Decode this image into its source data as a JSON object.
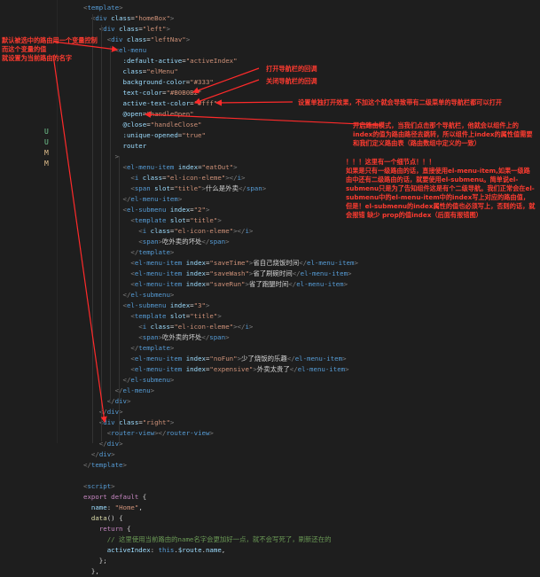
{
  "git_marks": [
    {
      "letter": "U",
      "color": "#73c991"
    },
    {
      "letter": "U",
      "color": "#73c991"
    },
    {
      "letter": "M",
      "color": "#e2c08d"
    },
    {
      "letter": "M",
      "color": "#e2c08d"
    }
  ],
  "code_lines": [
    [
      [
        "t-br",
        "<"
      ],
      [
        "t-tag",
        "template"
      ],
      [
        "t-br",
        ">"
      ]
    ],
    [
      [
        "t-br",
        "  <"
      ],
      [
        "t-tag",
        "div"
      ],
      [
        "t-txt",
        " "
      ],
      [
        "t-attr",
        "class"
      ],
      [
        "t-txt",
        "="
      ],
      [
        "t-str",
        "\"homeBox\""
      ],
      [
        "t-br",
        ">"
      ]
    ],
    [
      [
        "t-br",
        "    <"
      ],
      [
        "t-tag",
        "div"
      ],
      [
        "t-txt",
        " "
      ],
      [
        "t-attr",
        "class"
      ],
      [
        "t-txt",
        "="
      ],
      [
        "t-str",
        "\"left\""
      ],
      [
        "t-br",
        ">"
      ]
    ],
    [
      [
        "t-br",
        "      <"
      ],
      [
        "t-tag",
        "div"
      ],
      [
        "t-txt",
        " "
      ],
      [
        "t-attr",
        "class"
      ],
      [
        "t-txt",
        "="
      ],
      [
        "t-str",
        "\"leftNav\""
      ],
      [
        "t-br",
        ">"
      ]
    ],
    [
      [
        "t-br",
        "        <"
      ],
      [
        "t-tag",
        "el-menu"
      ]
    ],
    [
      [
        "t-txt",
        "          "
      ],
      [
        "t-attr",
        ":default-active"
      ],
      [
        "t-txt",
        "="
      ],
      [
        "t-str",
        "\"activeIndex\""
      ]
    ],
    [
      [
        "t-txt",
        "          "
      ],
      [
        "t-attr",
        "class"
      ],
      [
        "t-txt",
        "="
      ],
      [
        "t-str",
        "\"elMenu\""
      ]
    ],
    [
      [
        "t-txt",
        "          "
      ],
      [
        "t-attr",
        "background-color"
      ],
      [
        "t-txt",
        "="
      ],
      [
        "t-str",
        "\"#333\""
      ]
    ],
    [
      [
        "t-txt",
        "          "
      ],
      [
        "t-attr",
        "text-color"
      ],
      [
        "t-txt",
        "="
      ],
      [
        "t-str",
        "\"#B0B0B2\""
      ]
    ],
    [
      [
        "t-txt",
        "          "
      ],
      [
        "t-attr",
        "active-text-color"
      ],
      [
        "t-txt",
        "="
      ],
      [
        "t-str",
        "\"#fff\""
      ]
    ],
    [
      [
        "t-txt",
        "          "
      ],
      [
        "t-attr",
        "@open"
      ],
      [
        "t-txt",
        "="
      ],
      [
        "t-str",
        "\"handleOpen\""
      ]
    ],
    [
      [
        "t-txt",
        "          "
      ],
      [
        "t-attr",
        "@close"
      ],
      [
        "t-txt",
        "="
      ],
      [
        "t-str",
        "\"handleClose\""
      ]
    ],
    [
      [
        "t-txt",
        "          "
      ],
      [
        "t-attr",
        ":unique-opened"
      ],
      [
        "t-txt",
        "="
      ],
      [
        "t-str",
        "\"true\""
      ]
    ],
    [
      [
        "t-txt",
        "          "
      ],
      [
        "t-attr",
        "router"
      ]
    ],
    [
      [
        "t-br",
        "        >"
      ]
    ],
    [
      [
        "t-br",
        "          <"
      ],
      [
        "t-tag",
        "el-menu-item"
      ],
      [
        "t-txt",
        " "
      ],
      [
        "t-attr",
        "index"
      ],
      [
        "t-txt",
        "="
      ],
      [
        "t-str",
        "\"eatOut\""
      ],
      [
        "t-br",
        ">"
      ]
    ],
    [
      [
        "t-br",
        "            <"
      ],
      [
        "t-tag",
        "i"
      ],
      [
        "t-txt",
        " "
      ],
      [
        "t-attr",
        "class"
      ],
      [
        "t-txt",
        "="
      ],
      [
        "t-str",
        "\"el-icon-eleme\""
      ],
      [
        "t-br",
        "></"
      ],
      [
        "t-tag",
        "i"
      ],
      [
        "t-br",
        ">"
      ]
    ],
    [
      [
        "t-br",
        "            <"
      ],
      [
        "t-tag",
        "span"
      ],
      [
        "t-txt",
        " "
      ],
      [
        "t-attr",
        "slot"
      ],
      [
        "t-txt",
        "="
      ],
      [
        "t-str",
        "\"title\""
      ],
      [
        "t-br",
        ">"
      ],
      [
        "t-txt",
        "什么是外卖"
      ],
      [
        "t-br",
        "</"
      ],
      [
        "t-tag",
        "span"
      ],
      [
        "t-br",
        ">"
      ]
    ],
    [
      [
        "t-br",
        "          </"
      ],
      [
        "t-tag",
        "el-menu-item"
      ],
      [
        "t-br",
        ">"
      ]
    ],
    [
      [
        "t-br",
        "          <"
      ],
      [
        "t-tag",
        "el-submenu"
      ],
      [
        "t-txt",
        " "
      ],
      [
        "t-attr",
        "index"
      ],
      [
        "t-txt",
        "="
      ],
      [
        "t-str",
        "\"2\""
      ],
      [
        "t-br",
        ">"
      ]
    ],
    [
      [
        "t-br",
        "            <"
      ],
      [
        "t-tag",
        "template"
      ],
      [
        "t-txt",
        " "
      ],
      [
        "t-attr",
        "slot"
      ],
      [
        "t-txt",
        "="
      ],
      [
        "t-str",
        "\"title\""
      ],
      [
        "t-br",
        ">"
      ]
    ],
    [
      [
        "t-br",
        "              <"
      ],
      [
        "t-tag",
        "i"
      ],
      [
        "t-txt",
        " "
      ],
      [
        "t-attr",
        "class"
      ],
      [
        "t-txt",
        "="
      ],
      [
        "t-str",
        "\"el-icon-eleme\""
      ],
      [
        "t-br",
        "></"
      ],
      [
        "t-tag",
        "i"
      ],
      [
        "t-br",
        ">"
      ]
    ],
    [
      [
        "t-br",
        "              <"
      ],
      [
        "t-tag",
        "span"
      ],
      [
        "t-br",
        ">"
      ],
      [
        "t-txt",
        "吃外卖的坏处"
      ],
      [
        "t-br",
        "</"
      ],
      [
        "t-tag",
        "span"
      ],
      [
        "t-br",
        ">"
      ]
    ],
    [
      [
        "t-br",
        "            </"
      ],
      [
        "t-tag",
        "template"
      ],
      [
        "t-br",
        ">"
      ]
    ],
    [
      [
        "t-br",
        "            <"
      ],
      [
        "t-tag",
        "el-menu-item"
      ],
      [
        "t-txt",
        " "
      ],
      [
        "t-attr",
        "index"
      ],
      [
        "t-txt",
        "="
      ],
      [
        "t-str",
        "\"saveTime\""
      ],
      [
        "t-br",
        ">"
      ],
      [
        "t-txt",
        "省自己烧饭时间"
      ],
      [
        "t-br",
        "</"
      ],
      [
        "t-tag",
        "el-menu-item"
      ],
      [
        "t-br",
        ">"
      ]
    ],
    [
      [
        "t-br",
        "            <"
      ],
      [
        "t-tag",
        "el-menu-item"
      ],
      [
        "t-txt",
        " "
      ],
      [
        "t-attr",
        "index"
      ],
      [
        "t-txt",
        "="
      ],
      [
        "t-str",
        "\"saveWash\""
      ],
      [
        "t-br",
        ">"
      ],
      [
        "t-txt",
        "省了刷碗时间"
      ],
      [
        "t-br",
        "</"
      ],
      [
        "t-tag",
        "el-menu-item"
      ],
      [
        "t-br",
        ">"
      ]
    ],
    [
      [
        "t-br",
        "            <"
      ],
      [
        "t-tag",
        "el-menu-item"
      ],
      [
        "t-txt",
        " "
      ],
      [
        "t-attr",
        "index"
      ],
      [
        "t-txt",
        "="
      ],
      [
        "t-str",
        "\"saveRun\""
      ],
      [
        "t-br",
        ">"
      ],
      [
        "t-txt",
        "省了跑腿时间"
      ],
      [
        "t-br",
        "</"
      ],
      [
        "t-tag",
        "el-menu-item"
      ],
      [
        "t-br",
        ">"
      ]
    ],
    [
      [
        "t-br",
        "          </"
      ],
      [
        "t-tag",
        "el-submenu"
      ],
      [
        "t-br",
        ">"
      ]
    ],
    [
      [
        "t-br",
        "          <"
      ],
      [
        "t-tag",
        "el-submenu"
      ],
      [
        "t-txt",
        " "
      ],
      [
        "t-attr",
        "index"
      ],
      [
        "t-txt",
        "="
      ],
      [
        "t-str",
        "\"3\""
      ],
      [
        "t-br",
        ">"
      ]
    ],
    [
      [
        "t-br",
        "            <"
      ],
      [
        "t-tag",
        "template"
      ],
      [
        "t-txt",
        " "
      ],
      [
        "t-attr",
        "slot"
      ],
      [
        "t-txt",
        "="
      ],
      [
        "t-str",
        "\"title\""
      ],
      [
        "t-br",
        ">"
      ]
    ],
    [
      [
        "t-br",
        "              <"
      ],
      [
        "t-tag",
        "i"
      ],
      [
        "t-txt",
        " "
      ],
      [
        "t-attr",
        "class"
      ],
      [
        "t-txt",
        "="
      ],
      [
        "t-str",
        "\"el-icon-eleme\""
      ],
      [
        "t-br",
        "></"
      ],
      [
        "t-tag",
        "i"
      ],
      [
        "t-br",
        ">"
      ]
    ],
    [
      [
        "t-br",
        "              <"
      ],
      [
        "t-tag",
        "span"
      ],
      [
        "t-br",
        ">"
      ],
      [
        "t-txt",
        "吃外卖的坏处"
      ],
      [
        "t-br",
        "</"
      ],
      [
        "t-tag",
        "span"
      ],
      [
        "t-br",
        ">"
      ]
    ],
    [
      [
        "t-br",
        "            </"
      ],
      [
        "t-tag",
        "template"
      ],
      [
        "t-br",
        ">"
      ]
    ],
    [
      [
        "t-br",
        "            <"
      ],
      [
        "t-tag",
        "el-menu-item"
      ],
      [
        "t-txt",
        " "
      ],
      [
        "t-attr",
        "index"
      ],
      [
        "t-txt",
        "="
      ],
      [
        "t-str",
        "\"noFun\""
      ],
      [
        "t-br",
        ">"
      ],
      [
        "t-txt",
        "少了烧饭的乐趣"
      ],
      [
        "t-br",
        "</"
      ],
      [
        "t-tag",
        "el-menu-item"
      ],
      [
        "t-br",
        ">"
      ]
    ],
    [
      [
        "t-br",
        "            <"
      ],
      [
        "t-tag",
        "el-menu-item"
      ],
      [
        "t-txt",
        " "
      ],
      [
        "t-attr",
        "index"
      ],
      [
        "t-txt",
        "="
      ],
      [
        "t-str",
        "\"expensive\""
      ],
      [
        "t-br",
        ">"
      ],
      [
        "t-txt",
        "外卖太贵了"
      ],
      [
        "t-br",
        "</"
      ],
      [
        "t-tag",
        "el-menu-item"
      ],
      [
        "t-br",
        ">"
      ]
    ],
    [
      [
        "t-br",
        "          </"
      ],
      [
        "t-tag",
        "el-submenu"
      ],
      [
        "t-br",
        ">"
      ]
    ],
    [
      [
        "t-br",
        "        </"
      ],
      [
        "t-tag",
        "el-menu"
      ],
      [
        "t-br",
        ">"
      ]
    ],
    [
      [
        "t-br",
        "      </"
      ],
      [
        "t-tag",
        "div"
      ],
      [
        "t-br",
        ">"
      ]
    ],
    [
      [
        "t-br",
        "    </"
      ],
      [
        "t-tag",
        "div"
      ],
      [
        "t-br",
        ">"
      ]
    ],
    [
      [
        "t-br",
        "    <"
      ],
      [
        "t-tag",
        "div"
      ],
      [
        "t-txt",
        " "
      ],
      [
        "t-attr",
        "class"
      ],
      [
        "t-txt",
        "="
      ],
      [
        "t-str",
        "\"right\""
      ],
      [
        "t-br",
        ">"
      ]
    ],
    [
      [
        "t-br",
        "      <"
      ],
      [
        "t-tag",
        "router-view"
      ],
      [
        "t-br",
        "></"
      ],
      [
        "t-tag",
        "router-view"
      ],
      [
        "t-br",
        ">"
      ]
    ],
    [
      [
        "t-br",
        "    </"
      ],
      [
        "t-tag",
        "div"
      ],
      [
        "t-br",
        ">"
      ]
    ],
    [
      [
        "t-br",
        "  </"
      ],
      [
        "t-tag",
        "div"
      ],
      [
        "t-br",
        ">"
      ]
    ],
    [
      [
        "t-br",
        "</"
      ],
      [
        "t-tag",
        "template"
      ],
      [
        "t-br",
        ">"
      ]
    ],
    [],
    [
      [
        "t-br",
        "<"
      ],
      [
        "t-tag",
        "script"
      ],
      [
        "t-br",
        ">"
      ]
    ],
    [
      [
        "t-kw",
        "export"
      ],
      [
        "t-txt",
        " "
      ],
      [
        "t-kw",
        "default"
      ],
      [
        "t-txt",
        " {"
      ]
    ],
    [
      [
        "t-txt",
        "  "
      ],
      [
        "t-var",
        "name"
      ],
      [
        "t-txt",
        ": "
      ],
      [
        "t-str",
        "\"Home\""
      ],
      [
        "t-txt",
        ","
      ]
    ],
    [
      [
        "t-txt",
        "  "
      ],
      [
        "t-fn",
        "data"
      ],
      [
        "t-txt",
        "() {"
      ]
    ],
    [
      [
        "t-txt",
        "    "
      ],
      [
        "t-kw",
        "return"
      ],
      [
        "t-txt",
        " {"
      ]
    ],
    [
      [
        "t-com",
        "      // 这里使用当前路由的name名字会更加好一点，就不会写死了，刷新还在的"
      ]
    ],
    [
      [
        "t-txt",
        "      "
      ],
      [
        "t-var",
        "activeIndex"
      ],
      [
        "t-txt",
        ": "
      ],
      [
        "t-tag",
        "this"
      ],
      [
        "t-txt",
        "."
      ],
      [
        "t-var",
        "$route"
      ],
      [
        "t-txt",
        "."
      ],
      [
        "t-var",
        "name"
      ],
      [
        "t-txt",
        ","
      ]
    ],
    [
      [
        "t-txt",
        "    };"
      ]
    ],
    [
      [
        "t-txt",
        "  },"
      ]
    ]
  ],
  "annotations": {
    "left_note": "默认被选中的路由用一个变量控制\n而这个变量的值\n就设置为当前路由的名字",
    "open_note": "打开导航栏的回调",
    "close_note": "关闭导航栏的回调",
    "unique_note": "设置单独打开效果，不加这个就会导致带有二级菜单的导航栏都可以打开",
    "router_note": "开启路由模式，当我们点击那个导航栏，他就会以组件上的index的值为路由路径去跳转，所以组件上index的属性值需要和我们定义路由表（路由数组中定义的一致）",
    "detail_note": "！！！这里有一个细节点！！！\n如果是只有一级路由的话，直接使用el-menu-item,如果一级路由中还有二级路由的话，就要使用el-submenu。简单说el-submenu只是为了告知组件这是有个二级导航。我们正常会在el-submenu中的el-menu-item中的index写上对应的路由值，但是！el-submenu的index属性的值也必须写上，否则的话，就会报错 缺少 prop的值index（后面有报错图）"
  }
}
